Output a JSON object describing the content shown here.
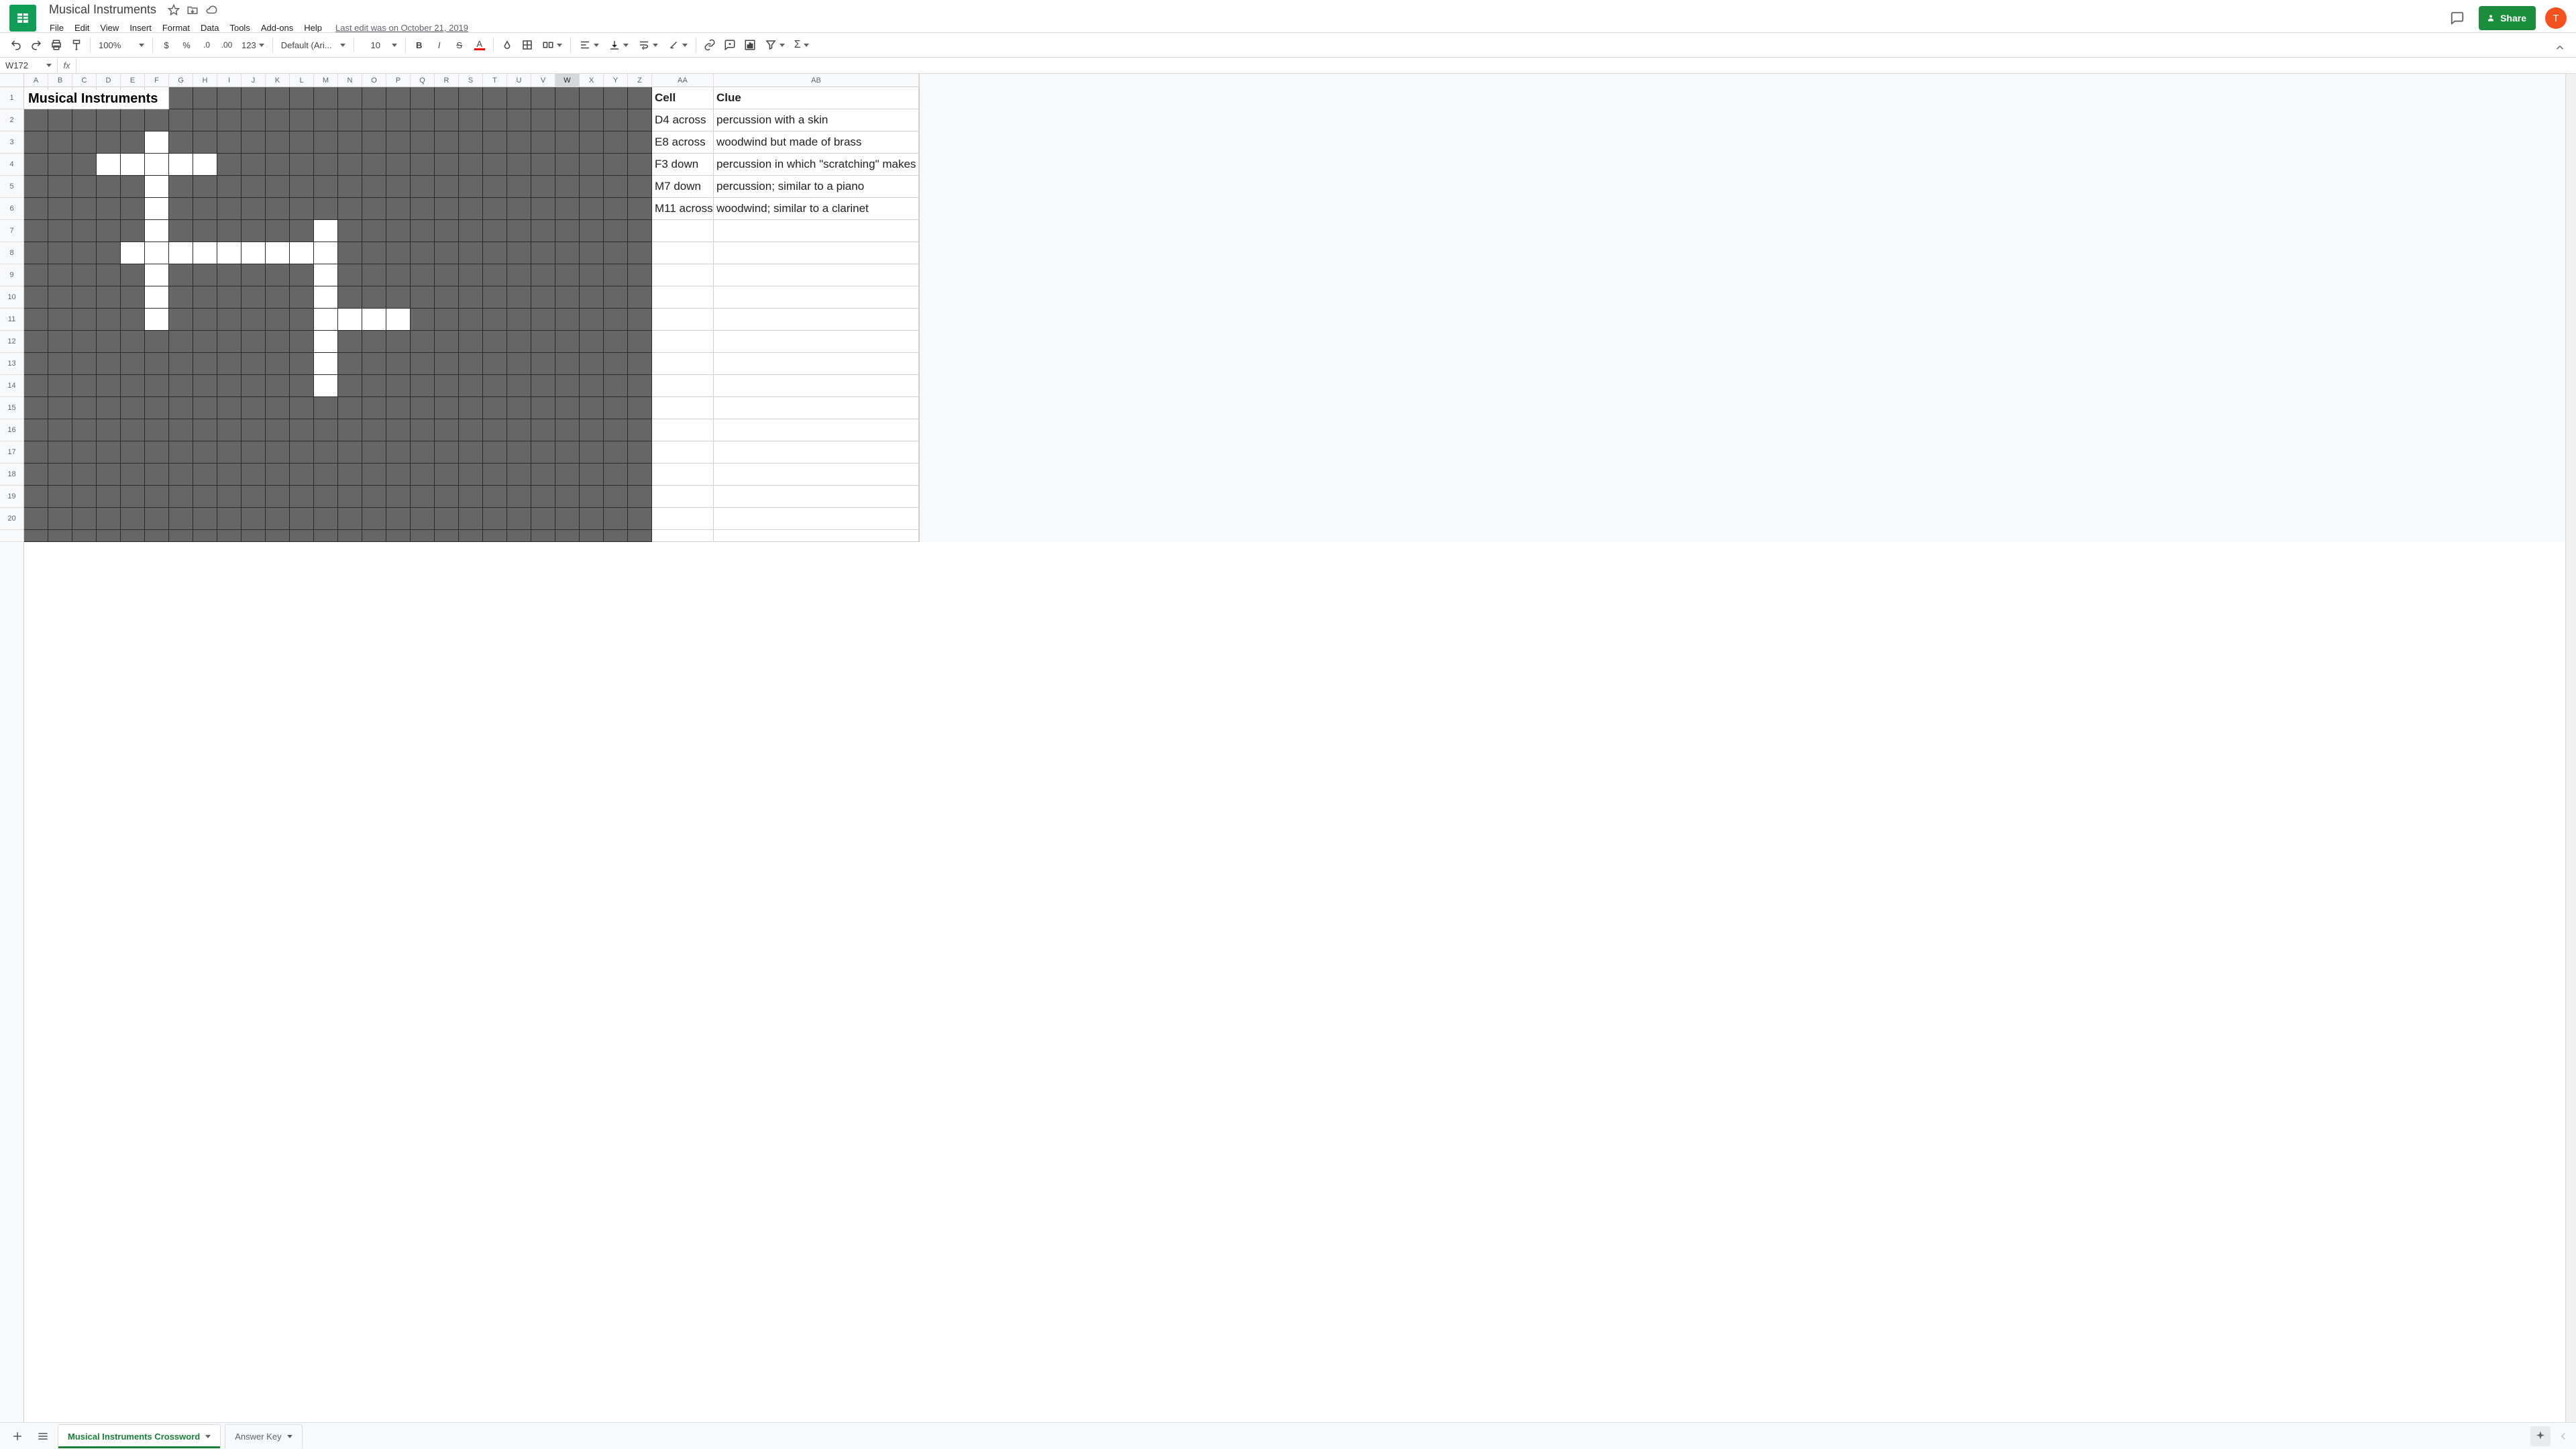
{
  "doc": {
    "title": "Musical Instruments",
    "last_edit": "Last edit was on October 21, 2019"
  },
  "menus": [
    "File",
    "Edit",
    "View",
    "Insert",
    "Format",
    "Data",
    "Tools",
    "Add-ons",
    "Help"
  ],
  "toolbar": {
    "zoom": "100%",
    "font": "Default (Ari...",
    "font_size": "10",
    "number_fmt": "123"
  },
  "share": {
    "label": "Share"
  },
  "avatar": {
    "initial": "T"
  },
  "name_box": "W172",
  "formula": "",
  "columns": [
    "A",
    "B",
    "C",
    "D",
    "E",
    "F",
    "G",
    "H",
    "I",
    "J",
    "K",
    "L",
    "M",
    "N",
    "O",
    "P",
    "Q",
    "R",
    "S",
    "T",
    "U",
    "V",
    "W",
    "X",
    "Y",
    "Z"
  ],
  "selected_column": "W",
  "extra_columns": [
    "AA",
    "AB"
  ],
  "row_count": 20,
  "crossword_title": "Musical Instruments",
  "white_cells": {
    "3": [
      "F"
    ],
    "4": [
      "D",
      "E",
      "F",
      "G",
      "H"
    ],
    "5": [
      "F"
    ],
    "6": [
      "F"
    ],
    "7": [
      "F",
      "M"
    ],
    "8": [
      "E",
      "F",
      "G",
      "H",
      "I",
      "J",
      "K",
      "L",
      "M"
    ],
    "9": [
      "F",
      "M"
    ],
    "10": [
      "F",
      "M"
    ],
    "11": [
      "F",
      "M",
      "N",
      "O",
      "P"
    ],
    "12": [
      "M"
    ],
    "13": [
      "M"
    ],
    "14": [
      "M"
    ]
  },
  "clues": {
    "head_cell": "Cell",
    "head_clue": "Clue",
    "rows": [
      {
        "cell": "D4 across",
        "clue": "percussion with a skin"
      },
      {
        "cell": "E8 across",
        "clue": "woodwind but made of brass"
      },
      {
        "cell": "F3 down",
        "clue": "percussion in which \"scratching\" makes sounds"
      },
      {
        "cell": "M7 down",
        "clue": "percussion; similar to a piano"
      },
      {
        "cell": "M11 across",
        "clue": "woodwind; similar to a clarinet"
      }
    ]
  },
  "tabs": {
    "active": "Musical Instruments Crossword",
    "inactive": "Answer Key"
  }
}
